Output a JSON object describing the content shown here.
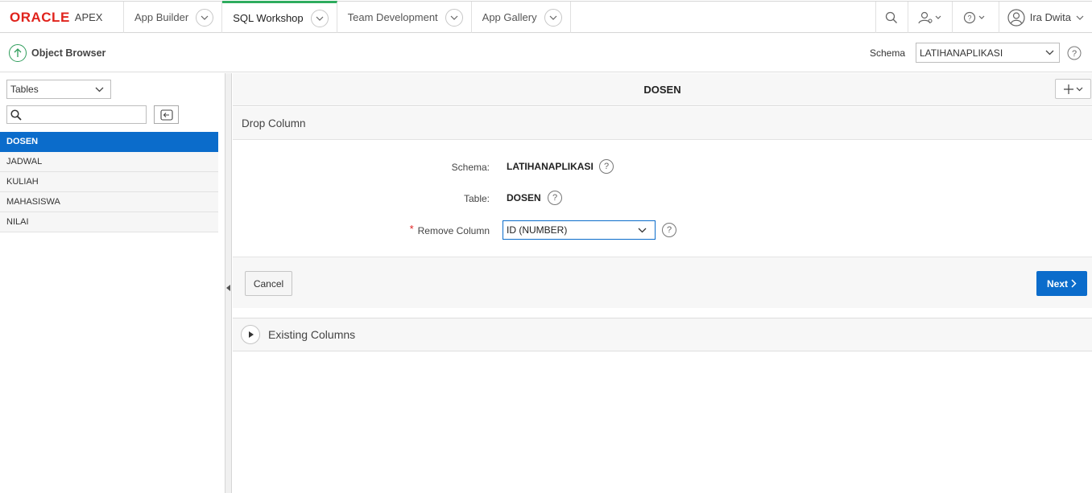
{
  "topnav": {
    "logo_oracle": "ORACLE",
    "logo_apex": "APEX",
    "tabs": [
      {
        "label": "App Builder"
      },
      {
        "label": "SQL Workshop"
      },
      {
        "label": "Team Development"
      },
      {
        "label": "App Gallery"
      }
    ],
    "user_name": "Ira Dwita"
  },
  "subbar": {
    "title": "Object Browser",
    "schema_label": "Schema",
    "schema_value": "LATIHANAPLIKASI"
  },
  "left": {
    "object_type": "Tables",
    "search_placeholder": "",
    "tables": [
      "DOSEN",
      "JADWAL",
      "KULIAH",
      "MAHASISWA",
      "NILAI"
    ]
  },
  "main": {
    "object_title": "DOSEN",
    "region_title": "Drop Column",
    "schema_label": "Schema:",
    "schema_value": "LATIHANAPLIKASI",
    "table_label": "Table:",
    "table_value": "DOSEN",
    "required_mark": "*",
    "remove_label": "Remove Column",
    "remove_value": "ID (NUMBER)",
    "cancel_label": "Cancel",
    "next_label": "Next",
    "existing_label": "Existing Columns"
  },
  "colors": {
    "accent": "#0b6ccb",
    "active_tab": "#2eac5e",
    "oracle_red": "#e0231c"
  }
}
